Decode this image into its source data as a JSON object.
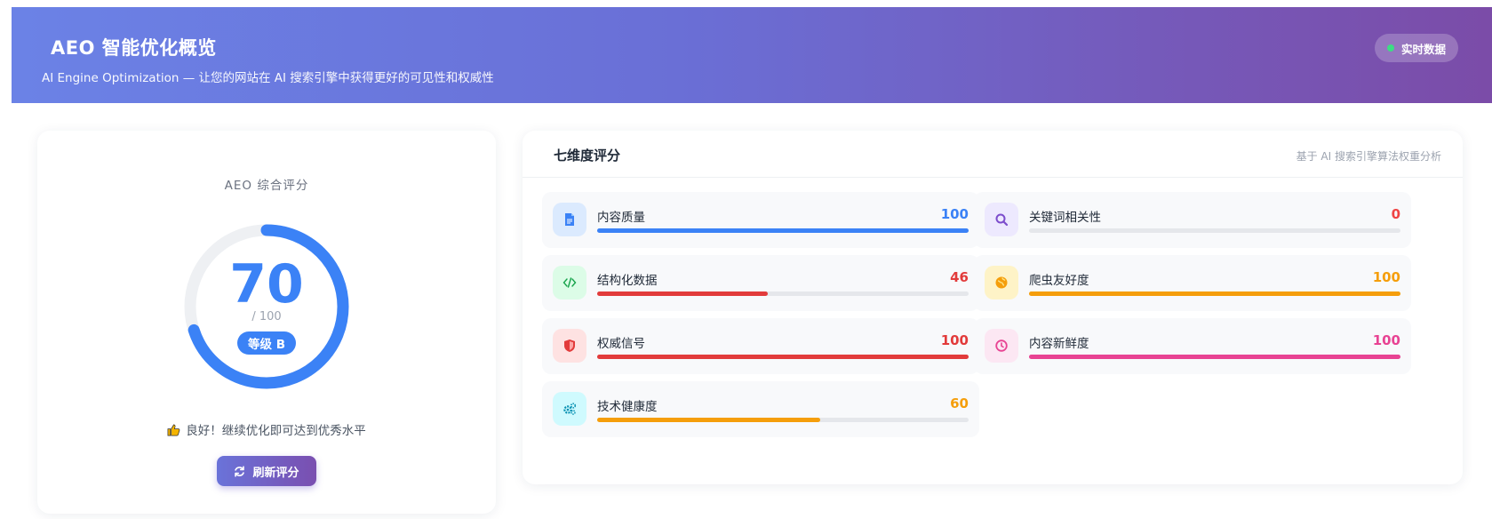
{
  "header": {
    "title": "AEO 智能优化概览",
    "subtitle": "AI Engine Optimization — 让您的网站在 AI 搜索引擎中获得更好的可见性和权威性",
    "live_badge": "实时数据"
  },
  "score": {
    "label": "AEO 综合评分",
    "value": "70",
    "max_text": "/ 100",
    "fraction": 0.7,
    "grade": "等级 B",
    "tip": "良好！继续优化即可达到优秀水平",
    "refresh_label": "刷新评分",
    "accent": "#3b82f6"
  },
  "dimensions": {
    "title": "七维度评分",
    "note": "基于 AI 搜索引擎算法权重分析",
    "items": [
      {
        "name": "内容质量",
        "score": "100",
        "value": 100,
        "color": "#3b82f6",
        "icon": "document-icon",
        "icon_bg": "#dbeafe"
      },
      {
        "name": "关键词相关性",
        "score": "0",
        "value": 0,
        "color": "#ef4444",
        "icon": "search-icon",
        "icon_bg": "#ede9fe"
      },
      {
        "name": "结构化数据",
        "score": "46",
        "value": 46,
        "color": "#e23b3b",
        "icon": "code-icon",
        "icon_bg": "#dcfce7"
      },
      {
        "name": "爬虫友好度",
        "score": "100",
        "value": 100,
        "color": "#f59e0b",
        "icon": "globe-icon",
        "icon_bg": "#fef3c7"
      },
      {
        "name": "权威信号",
        "score": "100",
        "value": 100,
        "color": "#e23b3b",
        "icon": "shield-icon",
        "icon_bg": "#fee2e2"
      },
      {
        "name": "内容新鲜度",
        "score": "100",
        "value": 100,
        "color": "#e84393",
        "icon": "clock-icon",
        "icon_bg": "#fce7f3"
      },
      {
        "name": "技术健康度",
        "score": "60",
        "value": 60,
        "color": "#f59e0b",
        "icon": "gears-icon",
        "icon_bg": "#cffafe"
      }
    ]
  }
}
